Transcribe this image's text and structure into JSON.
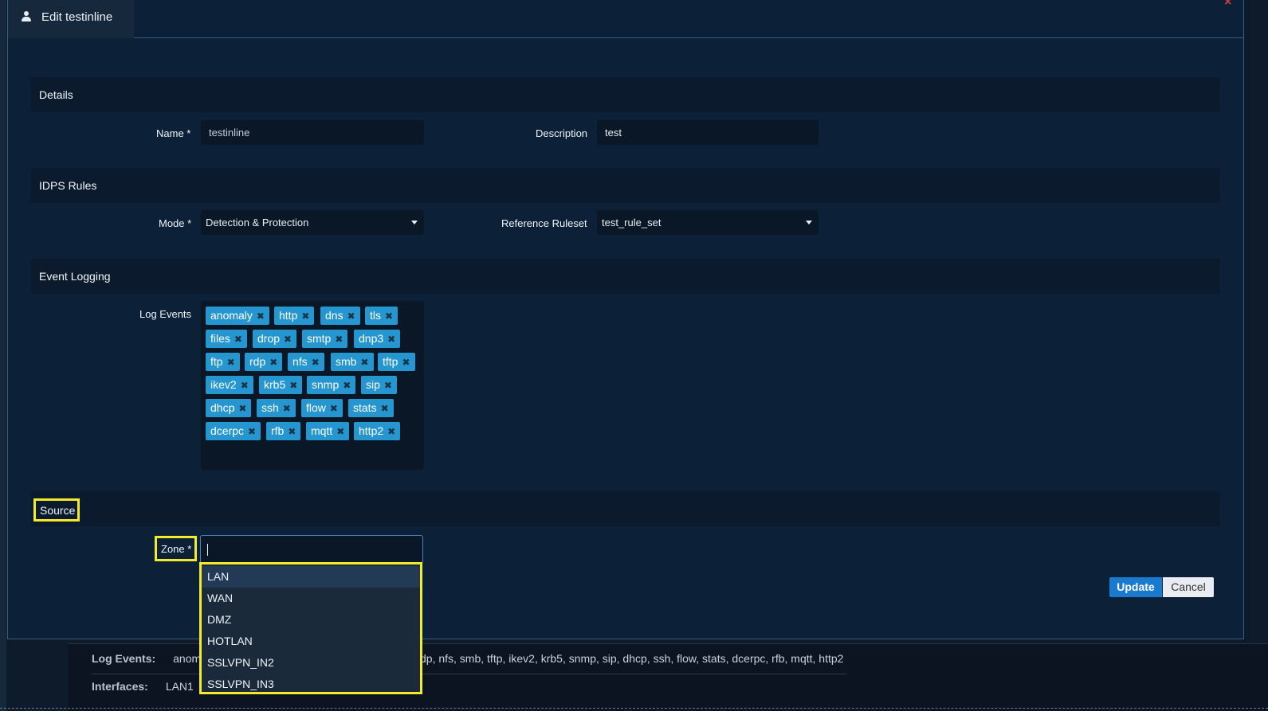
{
  "modal": {
    "title": "Edit testinline",
    "close_glyph": "×"
  },
  "sections": {
    "details": "Details",
    "idps_rules": "IDPS Rules",
    "event_logging": "Event Logging",
    "source": "Source"
  },
  "details": {
    "name_label": "Name *",
    "name_value": "testinline",
    "description_label": "Description",
    "description_value": "test"
  },
  "idps": {
    "mode_label": "Mode *",
    "mode_value": "Detection & Protection",
    "ruleset_label": "Reference Ruleset",
    "ruleset_value": "test_rule_set"
  },
  "logging": {
    "label": "Log Events",
    "tags": [
      "anomaly",
      "http",
      "dns",
      "tls",
      "files",
      "drop",
      "smtp",
      "dnp3",
      "ftp",
      "rdp",
      "nfs",
      "smb",
      "tftp",
      "ikev2",
      "krb5",
      "snmp",
      "sip",
      "dhcp",
      "ssh",
      "flow",
      "stats",
      "dcerpc",
      "rfb",
      "mqtt",
      "http2"
    ]
  },
  "source": {
    "zone_label": "Zone *",
    "zone_value": "",
    "zone_options": [
      "LAN",
      "WAN",
      "DMZ",
      "HOTLAN",
      "SSLVPN_IN2",
      "SSLVPN_IN3"
    ]
  },
  "buttons": {
    "update": "Update",
    "cancel": "Cancel"
  },
  "background": {
    "log_events_label": "Log Events:",
    "log_events_value_start": "anoma",
    "log_events_value_end": "dp, nfs, smb, tftp, ikev2, krb5, snmp, sip, dhcp, ssh, flow, stats, dcerpc, rfb, mqtt, http2",
    "interfaces_label": "Interfaces:",
    "interfaces_value": "LAN1"
  },
  "colors": {
    "tag": "#2596cf",
    "highlight": "#f3ea2a",
    "update_button": "#1a7ad0",
    "close": "#d43b3b"
  }
}
